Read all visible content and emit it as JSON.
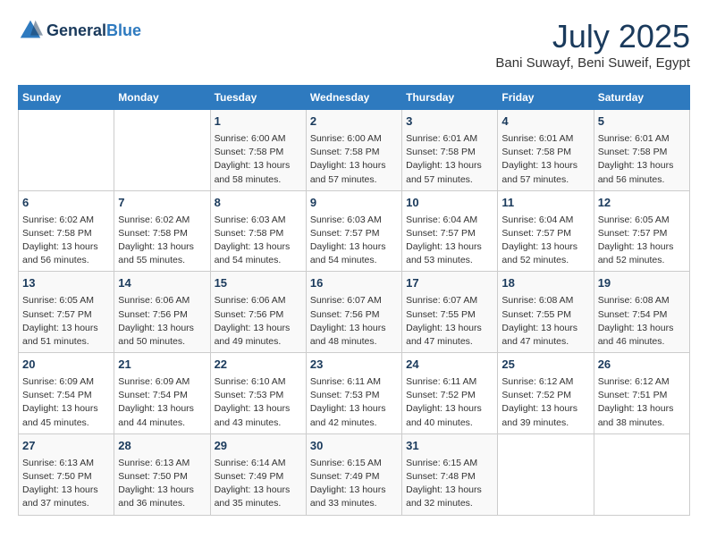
{
  "logo": {
    "general": "General",
    "blue": "Blue"
  },
  "title": "July 2025",
  "location": "Bani Suwayf, Beni Suweif, Egypt",
  "days_of_week": [
    "Sunday",
    "Monday",
    "Tuesday",
    "Wednesday",
    "Thursday",
    "Friday",
    "Saturday"
  ],
  "weeks": [
    [
      {
        "day": "",
        "content": ""
      },
      {
        "day": "",
        "content": ""
      },
      {
        "day": "1",
        "content": "Sunrise: 6:00 AM\nSunset: 7:58 PM\nDaylight: 13 hours and 58 minutes."
      },
      {
        "day": "2",
        "content": "Sunrise: 6:00 AM\nSunset: 7:58 PM\nDaylight: 13 hours and 57 minutes."
      },
      {
        "day": "3",
        "content": "Sunrise: 6:01 AM\nSunset: 7:58 PM\nDaylight: 13 hours and 57 minutes."
      },
      {
        "day": "4",
        "content": "Sunrise: 6:01 AM\nSunset: 7:58 PM\nDaylight: 13 hours and 57 minutes."
      },
      {
        "day": "5",
        "content": "Sunrise: 6:01 AM\nSunset: 7:58 PM\nDaylight: 13 hours and 56 minutes."
      }
    ],
    [
      {
        "day": "6",
        "content": "Sunrise: 6:02 AM\nSunset: 7:58 PM\nDaylight: 13 hours and 56 minutes."
      },
      {
        "day": "7",
        "content": "Sunrise: 6:02 AM\nSunset: 7:58 PM\nDaylight: 13 hours and 55 minutes."
      },
      {
        "day": "8",
        "content": "Sunrise: 6:03 AM\nSunset: 7:58 PM\nDaylight: 13 hours and 54 minutes."
      },
      {
        "day": "9",
        "content": "Sunrise: 6:03 AM\nSunset: 7:57 PM\nDaylight: 13 hours and 54 minutes."
      },
      {
        "day": "10",
        "content": "Sunrise: 6:04 AM\nSunset: 7:57 PM\nDaylight: 13 hours and 53 minutes."
      },
      {
        "day": "11",
        "content": "Sunrise: 6:04 AM\nSunset: 7:57 PM\nDaylight: 13 hours and 52 minutes."
      },
      {
        "day": "12",
        "content": "Sunrise: 6:05 AM\nSunset: 7:57 PM\nDaylight: 13 hours and 52 minutes."
      }
    ],
    [
      {
        "day": "13",
        "content": "Sunrise: 6:05 AM\nSunset: 7:57 PM\nDaylight: 13 hours and 51 minutes."
      },
      {
        "day": "14",
        "content": "Sunrise: 6:06 AM\nSunset: 7:56 PM\nDaylight: 13 hours and 50 minutes."
      },
      {
        "day": "15",
        "content": "Sunrise: 6:06 AM\nSunset: 7:56 PM\nDaylight: 13 hours and 49 minutes."
      },
      {
        "day": "16",
        "content": "Sunrise: 6:07 AM\nSunset: 7:56 PM\nDaylight: 13 hours and 48 minutes."
      },
      {
        "day": "17",
        "content": "Sunrise: 6:07 AM\nSunset: 7:55 PM\nDaylight: 13 hours and 47 minutes."
      },
      {
        "day": "18",
        "content": "Sunrise: 6:08 AM\nSunset: 7:55 PM\nDaylight: 13 hours and 47 minutes."
      },
      {
        "day": "19",
        "content": "Sunrise: 6:08 AM\nSunset: 7:54 PM\nDaylight: 13 hours and 46 minutes."
      }
    ],
    [
      {
        "day": "20",
        "content": "Sunrise: 6:09 AM\nSunset: 7:54 PM\nDaylight: 13 hours and 45 minutes."
      },
      {
        "day": "21",
        "content": "Sunrise: 6:09 AM\nSunset: 7:54 PM\nDaylight: 13 hours and 44 minutes."
      },
      {
        "day": "22",
        "content": "Sunrise: 6:10 AM\nSunset: 7:53 PM\nDaylight: 13 hours and 43 minutes."
      },
      {
        "day": "23",
        "content": "Sunrise: 6:11 AM\nSunset: 7:53 PM\nDaylight: 13 hours and 42 minutes."
      },
      {
        "day": "24",
        "content": "Sunrise: 6:11 AM\nSunset: 7:52 PM\nDaylight: 13 hours and 40 minutes."
      },
      {
        "day": "25",
        "content": "Sunrise: 6:12 AM\nSunset: 7:52 PM\nDaylight: 13 hours and 39 minutes."
      },
      {
        "day": "26",
        "content": "Sunrise: 6:12 AM\nSunset: 7:51 PM\nDaylight: 13 hours and 38 minutes."
      }
    ],
    [
      {
        "day": "27",
        "content": "Sunrise: 6:13 AM\nSunset: 7:50 PM\nDaylight: 13 hours and 37 minutes."
      },
      {
        "day": "28",
        "content": "Sunrise: 6:13 AM\nSunset: 7:50 PM\nDaylight: 13 hours and 36 minutes."
      },
      {
        "day": "29",
        "content": "Sunrise: 6:14 AM\nSunset: 7:49 PM\nDaylight: 13 hours and 35 minutes."
      },
      {
        "day": "30",
        "content": "Sunrise: 6:15 AM\nSunset: 7:49 PM\nDaylight: 13 hours and 33 minutes."
      },
      {
        "day": "31",
        "content": "Sunrise: 6:15 AM\nSunset: 7:48 PM\nDaylight: 13 hours and 32 minutes."
      },
      {
        "day": "",
        "content": ""
      },
      {
        "day": "",
        "content": ""
      }
    ]
  ]
}
